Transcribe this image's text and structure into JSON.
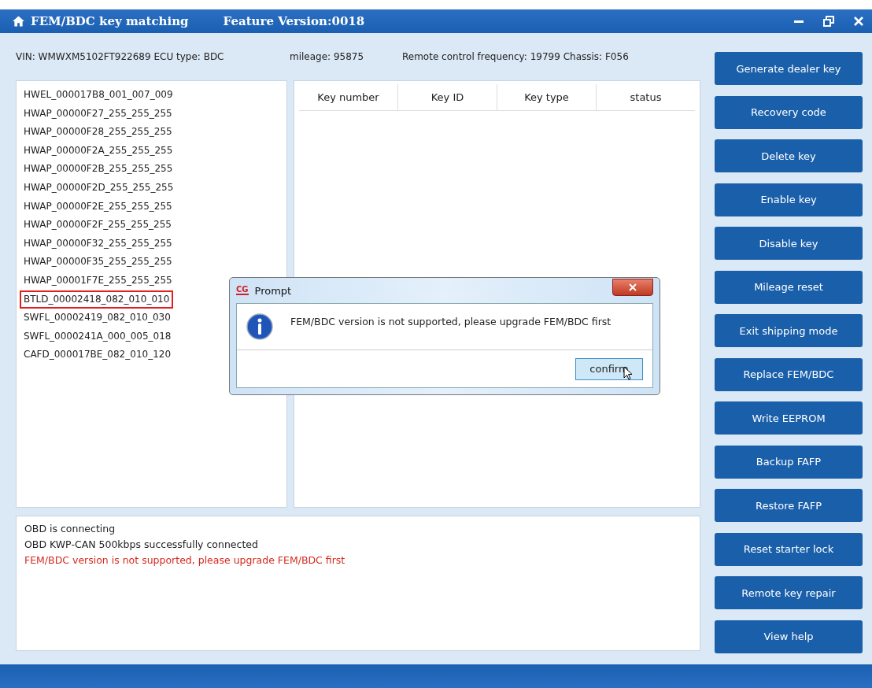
{
  "window": {
    "title": "FEM/BDC key matching",
    "feature_version": "Feature Version:0018"
  },
  "info": [
    "VIN: WMWXM5102FT922689  ECU type: BDC",
    "mileage: 95875",
    "Remote control frequency: 19799  Chassis: F056"
  ],
  "modules": [
    {
      "label": "HWEL_000017B8_001_007_009",
      "selected": false
    },
    {
      "label": "HWAP_00000F27_255_255_255",
      "selected": false
    },
    {
      "label": "HWAP_00000F28_255_255_255",
      "selected": false
    },
    {
      "label": "HWAP_00000F2A_255_255_255",
      "selected": false
    },
    {
      "label": "HWAP_00000F2B_255_255_255",
      "selected": false
    },
    {
      "label": "HWAP_00000F2D_255_255_255",
      "selected": false
    },
    {
      "label": "HWAP_00000F2E_255_255_255",
      "selected": false
    },
    {
      "label": "HWAP_00000F2F_255_255_255",
      "selected": false
    },
    {
      "label": "HWAP_00000F32_255_255_255",
      "selected": false
    },
    {
      "label": "HWAP_00000F35_255_255_255",
      "selected": false
    },
    {
      "label": "HWAP_00001F7E_255_255_255",
      "selected": false
    },
    {
      "label": "BTLD_00002418_082_010_010",
      "selected": true
    },
    {
      "label": "SWFL_00002419_082_010_030",
      "selected": false
    },
    {
      "label": "SWFL_0000241A_000_005_018",
      "selected": false
    },
    {
      "label": "CAFD_000017BE_082_010_120",
      "selected": false
    }
  ],
  "table": {
    "columns": [
      "Key number",
      "Key ID",
      "Key type",
      "status"
    ]
  },
  "log": [
    {
      "text": "OBD is connecting",
      "kind": "info"
    },
    {
      "text": "OBD KWP-CAN 500kbps successfully connected",
      "kind": "info"
    },
    {
      "text": "FEM/BDC version is not supported, please upgrade FEM/BDC first",
      "kind": "error"
    }
  ],
  "buttons": [
    "Generate dealer key",
    "Recovery code",
    "Delete key",
    "Enable key",
    "Disable key",
    "Mileage reset",
    "Exit shipping mode",
    "Replace FEM/BDC",
    "Write EEPROM",
    "Backup FAFP",
    "Restore FAFP",
    "Reset starter lock",
    "Remote key repair",
    "View help"
  ],
  "dialog": {
    "title": "Prompt",
    "logo": "CG",
    "message": "FEM/BDC version is not supported, please upgrade FEM/BDC first",
    "button": "confirm"
  }
}
